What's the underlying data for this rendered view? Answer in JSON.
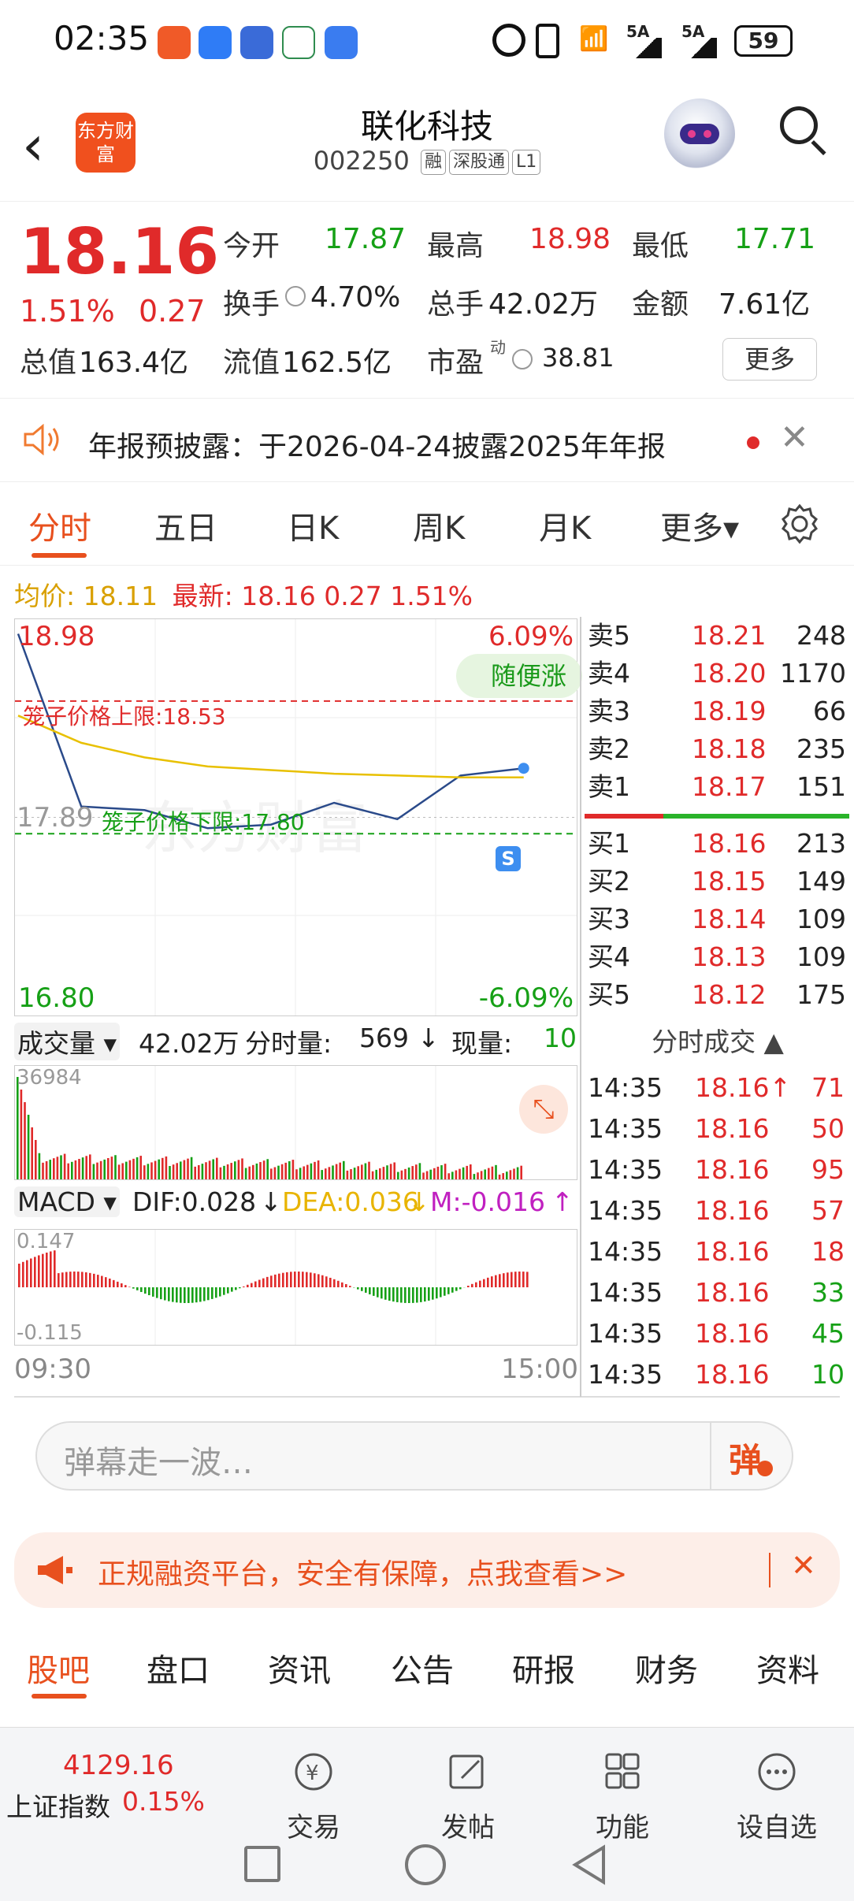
{
  "status_bar": {
    "time": "02:35",
    "battery": "59",
    "net1": "5A",
    "net2": "5A"
  },
  "header": {
    "logo_text": "东方财富",
    "stock_name": "联化科技",
    "stock_code": "002250",
    "tags": [
      "融",
      "深股通",
      "L1"
    ]
  },
  "quote": {
    "price": "18.16",
    "change_pct": "1.51%",
    "change": "0.27",
    "open_label": "今开",
    "open": "17.87",
    "high_label": "最高",
    "high": "18.98",
    "low_label": "最低",
    "low": "17.71",
    "turnover_label": "换手",
    "turnover": "4.70%",
    "volume_label": "总手",
    "volume": "42.02万",
    "amount_label": "金额",
    "amount": "7.61亿",
    "mktcap_label": "总值",
    "mktcap": "163.4亿",
    "float_label": "流值",
    "float_cap": "162.5亿",
    "pe_label": "市盈",
    "pe_sup": "动",
    "pe": "38.81",
    "more_label": "更多"
  },
  "notice": {
    "text": "年报预披露：于2026-04-24披露2025年年报"
  },
  "tabs": [
    "分时",
    "五日",
    "日K",
    "周K",
    "月K",
    "更多▾"
  ],
  "info_line": {
    "avg_label": "均价:",
    "avg": "18.11",
    "latest_label": "最新:",
    "latest": "18.16",
    "chg": "0.27",
    "pct": "1.51%"
  },
  "chart": {
    "y_top": "18.98",
    "y_bottom": "16.80",
    "pct_top": "6.09%",
    "pct_bottom": "-6.09%",
    "prev_close": "17.89",
    "upper_limit_label": "笼子价格上限:18.53",
    "lower_limit_label": "笼子价格下限:17.80",
    "badge": "随便涨",
    "s_badge": "S",
    "watermark": "东方财富",
    "vol_label": "成交量 ▾",
    "vol_total": "42.02万",
    "tick_vol_label": "分时量:",
    "tick_vol": "569",
    "now_vol_label": "现量:",
    "now_vol": "10",
    "vol_max": "36984",
    "macd_label": "MACD ▾",
    "dif": "DIF:0.028",
    "dea": "DEA:0.036",
    "m": "M:-0.016",
    "macd_top": "0.147",
    "macd_bottom": "-0.115",
    "time_start": "09:30",
    "time_end": "15:00"
  },
  "chart_data": {
    "type": "line",
    "x": [
      "09:30",
      "10:00",
      "10:30",
      "11:00",
      "11:30",
      "13:30",
      "14:00",
      "14:30",
      "14:35"
    ],
    "series": [
      {
        "values": [
          18.9,
          17.95,
          17.93,
          17.83,
          17.85,
          17.97,
          17.88,
          18.12,
          18.16
        ]
      },
      {
        "values": [
          18.45,
          18.3,
          18.22,
          18.17,
          18.15,
          18.13,
          18.12,
          18.11,
          18.11
        ]
      }
    ],
    "ylim": [
      16.8,
      18.98
    ]
  },
  "order_book": {
    "asks": [
      {
        "label": "卖5",
        "price": "18.21",
        "vol": "248"
      },
      {
        "label": "卖4",
        "price": "18.20",
        "vol": "1170"
      },
      {
        "label": "卖3",
        "price": "18.19",
        "vol": "66"
      },
      {
        "label": "卖2",
        "price": "18.18",
        "vol": "235"
      },
      {
        "label": "卖1",
        "price": "18.17",
        "vol": "151"
      }
    ],
    "bids": [
      {
        "label": "买1",
        "price": "18.16",
        "vol": "213"
      },
      {
        "label": "买2",
        "price": "18.15",
        "vol": "149"
      },
      {
        "label": "买3",
        "price": "18.14",
        "vol": "109"
      },
      {
        "label": "买4",
        "price": "18.13",
        "vol": "109"
      },
      {
        "label": "买5",
        "price": "18.12",
        "vol": "175"
      }
    ]
  },
  "ticks": {
    "title": "分时成交 ▲",
    "rows": [
      {
        "time": "14:35",
        "price": "18.16↑",
        "vol": "71",
        "color": "#e02a2a"
      },
      {
        "time": "14:35",
        "price": "18.16",
        "vol": "50",
        "color": "#e02a2a"
      },
      {
        "time": "14:35",
        "price": "18.16",
        "vol": "95",
        "color": "#e02a2a"
      },
      {
        "time": "14:35",
        "price": "18.16",
        "vol": "57",
        "color": "#e02a2a"
      },
      {
        "time": "14:35",
        "price": "18.16",
        "vol": "18",
        "color": "#e02a2a"
      },
      {
        "time": "14:35",
        "price": "18.16",
        "vol": "33",
        "color": "#16a016"
      },
      {
        "time": "14:35",
        "price": "18.16",
        "vol": "45",
        "color": "#16a016"
      },
      {
        "time": "14:35",
        "price": "18.16",
        "vol": "10",
        "color": "#16a016"
      }
    ]
  },
  "danmu": {
    "placeholder": "弹幕走一波…",
    "button": "弹"
  },
  "ad": {
    "text": "正规融资平台，安全有保障，点我查看>>"
  },
  "bottom_tabs": [
    "股吧",
    "盘口",
    "资讯",
    "公告",
    "研报",
    "财务",
    "资料"
  ],
  "index": {
    "value": "4129.16",
    "name": "上证指数",
    "pct": "0.15%"
  },
  "nav": {
    "trade": "交易",
    "post": "发帖",
    "func": "功能",
    "watch": "设自选"
  }
}
